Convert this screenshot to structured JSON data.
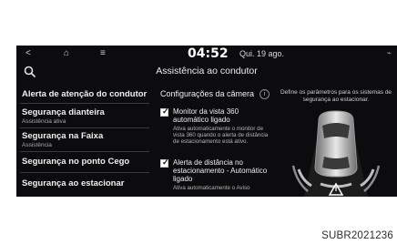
{
  "statusbar": {
    "back_icon": "<",
    "home_icon": "⌂",
    "menu_icon": "≡",
    "time": "04:52",
    "date": "Qui. 19 ago.",
    "right_icon": "⌁"
  },
  "header": {
    "title": "Assistência ao condutor"
  },
  "sidebar": {
    "items": [
      {
        "label": "Alerta de atenção do condutor",
        "sub": ""
      },
      {
        "label": "Segurança dianteira",
        "sub": "Assistência ativa"
      },
      {
        "label": "Segurança na Faixa",
        "sub": "Assistência"
      },
      {
        "label": "Segurança no ponto Cego",
        "sub": ""
      },
      {
        "label": "Segurança ao estacionar",
        "sub": ""
      }
    ]
  },
  "center": {
    "title": "Configurações da câmera",
    "info_icon": "i",
    "options": [
      {
        "title": "Monitor da vista 360 automático ligado",
        "desc": "Ativa automaticamente o monitor de vista 360 quando o alerta de distância de estacionamento está ativo.",
        "checked": true
      },
      {
        "title": "Alerta de distância no estacionamento - Automático ligado",
        "desc": "Ativa automaticamente o Aviso",
        "checked": true
      }
    ]
  },
  "right_panel": {
    "description": "Define os parâmetros para os sistemas de segurança ao estacionar."
  },
  "caption": "SUBR2021236"
}
